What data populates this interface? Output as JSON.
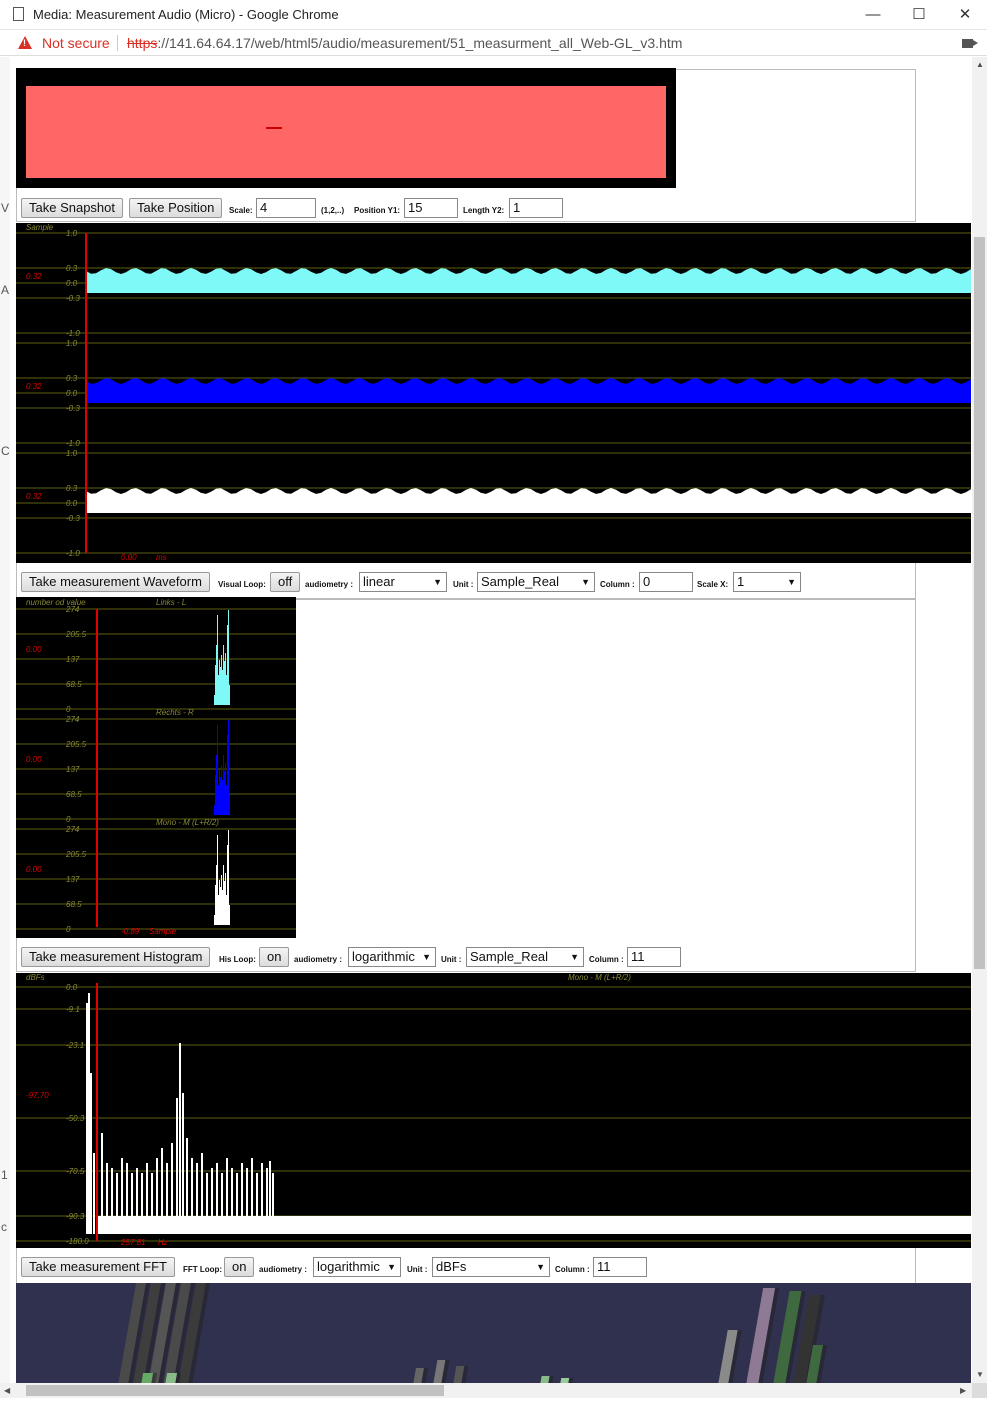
{
  "window": {
    "title": "Media: Measurement Audio (Micro) - Google Chrome",
    "minimize": "—",
    "maximize": "☐",
    "close": "✕"
  },
  "address": {
    "security": "Not secure",
    "scheme": "https",
    "rest": "://141.64.64.17/web/html5/audio/measurement/51_measurment_all_Web-GL_v3.htm"
  },
  "left_letters": [
    "V",
    "A",
    "C",
    "1",
    "c"
  ],
  "snapshot": {
    "take_snapshot": "Take Snapshot",
    "take_position": "Take Position",
    "scale_label": "Scale:",
    "scale_value": "4",
    "scale_hint": "(1,2,..)",
    "pos_label": "Position Y1:",
    "pos_value": "15",
    "len_label": "Length Y2:",
    "len_value": "1",
    "colors": {
      "frame": "#000000",
      "fill": "#ff6666",
      "marker": "#cc0000"
    }
  },
  "waveform": {
    "title": "Sample",
    "channels": [
      {
        "color": "#7ff8f8",
        "ticks": [
          "1.0",
          "0.3",
          "0.0",
          "-0.3",
          "-1.0"
        ],
        "marker": "0.32"
      },
      {
        "color": "#0000ff",
        "ticks": [
          "1.0",
          "0.3",
          "0.0",
          "-0.3",
          "-1.0"
        ],
        "marker": "0.32"
      },
      {
        "color": "#ffffff",
        "ticks": [
          "1.0",
          "0.3",
          "0.0",
          "-0.3",
          "-1.0"
        ],
        "marker": "0.32"
      }
    ],
    "cursor_value": "0.00",
    "cursor_unit": "ms",
    "controls": {
      "take": "Take measurement Waveform",
      "loop_label": "Visual Loop:",
      "loop_value": "off",
      "audiometry_label": "audiometry :",
      "audiometry_value": "linear",
      "unit_label": "Unit :",
      "unit_value": "Sample_Real",
      "column_label": "Column :",
      "column_value": "0",
      "scalex_label": "Scale X:",
      "scalex_value": "1"
    }
  },
  "histogram": {
    "ylabel": "number od value",
    "channels": [
      {
        "name": "Links - L",
        "color": "#7ff8f8",
        "ticks": [
          "274",
          "205.5",
          "137",
          "68.5",
          "0"
        ],
        "marker": "0.00"
      },
      {
        "name": "Rechts - R",
        "color": "#0000ff",
        "ticks": [
          "274",
          "205.5",
          "137",
          "68.5",
          "0"
        ],
        "marker": "0.00"
      },
      {
        "name": "Mono - M (L+R/2)",
        "color": "#ffffff",
        "ticks": [
          "274",
          "205.5",
          "137",
          "68.5",
          "0"
        ],
        "marker": "0.00"
      }
    ],
    "cursor_value": "-0.89",
    "cursor_unit": "Sample",
    "controls": {
      "take": "Take measurement Histogram",
      "loop_label": "His Loop:",
      "loop_value": "on",
      "audiometry_label": "audiometry :",
      "audiometry_value": "logarithmic",
      "unit_label": "Unit :",
      "unit_value": "Sample_Real",
      "column_label": "Column :",
      "column_value": "11"
    }
  },
  "fft": {
    "ylabel": "dBFs",
    "channel": "Mono - M (L+R/2)",
    "ticks": [
      "0.0",
      "-9.1",
      "-23.1",
      "-50.3",
      "-70.5",
      "-90.3",
      "-180.0"
    ],
    "marker": "-97.70",
    "cursor_value": "257.81",
    "cursor_unit": "Hz",
    "controls": {
      "take": "Take measurement FFT",
      "loop_label": "FFT Loop:",
      "loop_value": "on",
      "audiometry_label": "audiometry :",
      "audiometry_value": "logarithmic",
      "unit_label": "Unit :",
      "unit_value": "dBFs",
      "column_label": "Column :",
      "column_value": "11"
    }
  },
  "webgl": {
    "background": "#30304f"
  }
}
